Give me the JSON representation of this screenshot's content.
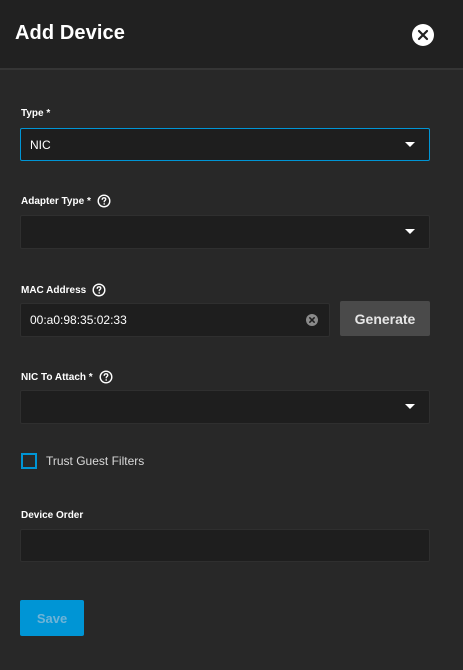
{
  "dialog": {
    "title": "Add Device",
    "close_icon": "close-icon"
  },
  "form": {
    "type": {
      "label": "Type *",
      "value": "NIC"
    },
    "adapter_type": {
      "label": "Adapter Type *",
      "value": ""
    },
    "mac_address": {
      "label": "MAC Address",
      "value": "00:a0:98:35:02:33",
      "generate_label": "Generate"
    },
    "nic_to_attach": {
      "label": "NIC To Attach *",
      "value": ""
    },
    "trust_guest_filters": {
      "label": "Trust Guest Filters",
      "checked": false
    },
    "device_order": {
      "label": "Device Order",
      "value": ""
    },
    "save_label": "Save"
  },
  "colors": {
    "background": "#282828",
    "header": "#212121",
    "field": "#1e1e1e",
    "accent": "#0095d5",
    "generate_button": "#4a4a4a"
  }
}
